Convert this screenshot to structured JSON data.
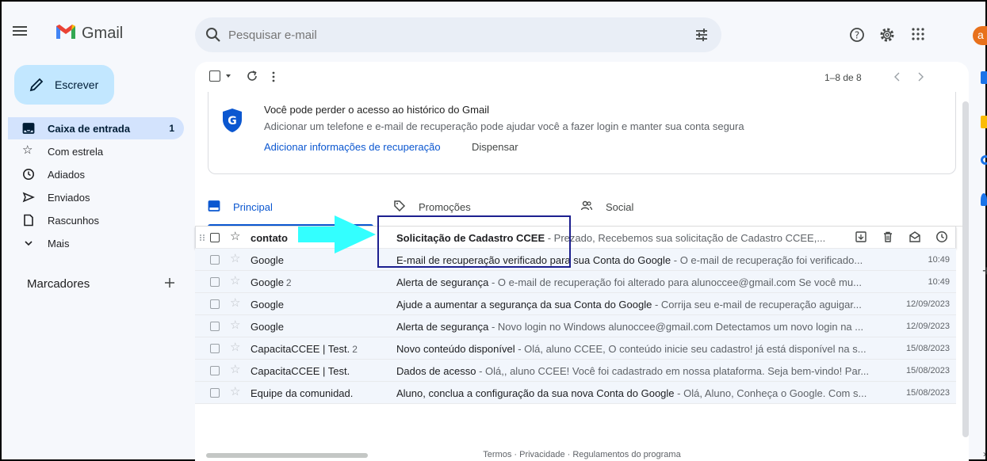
{
  "header": {
    "app_name": "Gmail",
    "search_placeholder": "Pesquisar e-mail",
    "avatar_initial": "a"
  },
  "sidebar": {
    "compose_label": "Escrever",
    "items": [
      {
        "label": "Caixa de entrada",
        "count": "1",
        "icon": "inbox-icon",
        "active": true
      },
      {
        "label": "Com estrela",
        "count": "",
        "icon": "star-icon"
      },
      {
        "label": "Adiados",
        "count": "",
        "icon": "clock-icon"
      },
      {
        "label": "Enviados",
        "count": "",
        "icon": "send-icon"
      },
      {
        "label": "Rascunhos",
        "count": "",
        "icon": "draft-icon"
      },
      {
        "label": "Mais",
        "count": "",
        "icon": "chevron-down-icon"
      }
    ],
    "labels_title": "Marcadores"
  },
  "toolbar": {
    "page_range": "1–8 de 8"
  },
  "banner": {
    "title": "Você pode perder o acesso ao histórico do Gmail",
    "text": "Adicionar um telefone e e-mail de recuperação pode ajudar você a fazer login e manter sua conta segura",
    "link": "Adicionar informações de recuperação",
    "dismiss": "Dispensar"
  },
  "tabs": [
    {
      "label": "Principal",
      "icon": "inbox-icon",
      "active": true
    },
    {
      "label": "Promoções",
      "icon": "tag-icon"
    },
    {
      "label": "Social",
      "icon": "people-icon"
    }
  ],
  "emails": [
    {
      "sender": "contato",
      "count": "",
      "subject": "Solicitação de Cadastro CCEE",
      "snippet": " - Prezado, Recebemos sua solicitação de Cadastro CCEE,...",
      "date": "",
      "unread": true,
      "hovered": true
    },
    {
      "sender": "Google",
      "count": "",
      "subject": "E-mail de recuperação verificado para sua Conta do Google",
      "snippet": " - O e-mail de recuperação foi verificado...",
      "date": "10:49"
    },
    {
      "sender": "Google",
      "count": "2",
      "subject": "Alerta de segurança",
      "snippet": " - O e-mail de recuperação foi alterado para alunoccee@gmail.com Se você mu...",
      "date": "10:49"
    },
    {
      "sender": "Google",
      "count": "",
      "subject": "Ajude a aumentar a segurança da sua Conta do Google",
      "snippet": " - Corrija seu e-mail de recuperação aguigar...",
      "date": "12/09/2023"
    },
    {
      "sender": "Google",
      "count": "",
      "subject": "Alerta de segurança",
      "snippet": " - Novo login no Windows alunoccee@gmail.com Detectamos um novo login na ...",
      "date": "12/09/2023"
    },
    {
      "sender": "CapacitaCCEE | Test.",
      "count": "2",
      "subject": "Novo conteúdo disponível",
      "snippet": " - Olá, aluno CCEE, O conteúdo inicie seu cadastro! já está disponível na s...",
      "date": "15/08/2023"
    },
    {
      "sender": "CapacitaCCEE | Test.",
      "count": "",
      "subject": "Dados de acesso",
      "snippet": " - Olá,, aluno CCEE! Você foi cadastrado em nossa plataforma. Seja bem-vindo! Par...",
      "date": "15/08/2023"
    },
    {
      "sender": "Equipe da comunidad.",
      "count": "",
      "subject": "Aluno, conclua a configuração da sua nova Conta do Google",
      "snippet": " - Olá, Aluno, Conheça o Google. Com s...",
      "date": "15/08/2023"
    }
  ],
  "footer": {
    "links": "Termos · Privacidade · Regulamentos do programa"
  },
  "colors": {
    "accent": "#0b57d0",
    "compose_bg": "#c2e7ff",
    "annotation_arrow": "#33ffff",
    "annotation_box": "#1c1f8f"
  }
}
